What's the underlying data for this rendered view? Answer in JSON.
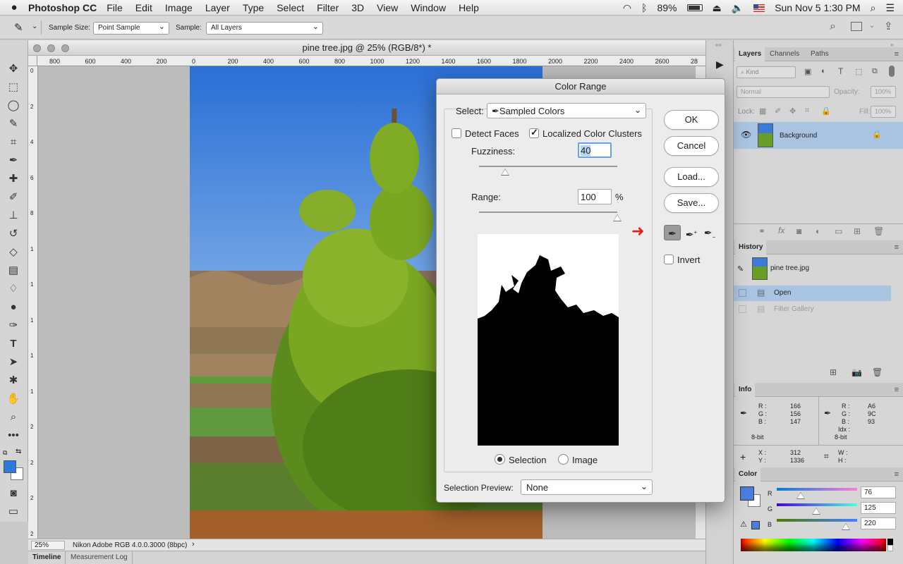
{
  "menubar": {
    "apple": "",
    "app_name": "Photoshop CC",
    "items": [
      "File",
      "Edit",
      "Image",
      "Layer",
      "Type",
      "Select",
      "Filter",
      "3D",
      "View",
      "Window",
      "Help"
    ],
    "battery": "89%",
    "datetime": "Sun Nov 5  1:30 PM"
  },
  "options": {
    "sample_size_label": "Sample Size:",
    "sample_size_value": "Point Sample",
    "sample_label": "Sample:",
    "sample_value": "All Layers"
  },
  "document": {
    "title": "pine tree.jpg @ 25% (RGB/8*) *",
    "zoom": "25%",
    "profile": "Nikon Adobe RGB 4.0.0.3000 (8bpc)",
    "ruler_h": [
      "800",
      "600",
      "400",
      "200",
      "0",
      "200",
      "400",
      "600",
      "800",
      "1000",
      "1200",
      "1400",
      "1600",
      "1800",
      "2000",
      "2200",
      "2400",
      "2600",
      "28"
    ],
    "ruler_v": [
      "0",
      "2",
      "4",
      "6",
      "8",
      "1",
      "1",
      "1",
      "1",
      "1",
      "2",
      "2",
      "2",
      "2"
    ]
  },
  "bottom_tabs": [
    "Timeline",
    "Measurement Log"
  ],
  "dialog": {
    "title": "Color Range",
    "select_label": "Select:",
    "select_value": "Sampled Colors",
    "detect_faces": "Detect Faces",
    "localized": "Localized Color Clusters",
    "fuzziness_label": "Fuzziness:",
    "fuzziness_value": "40",
    "fuzziness_level": 0.19,
    "range_label": "Range:",
    "range_value": "100",
    "range_unit": "%",
    "range_level": 1.0,
    "ok": "OK",
    "cancel": "Cancel",
    "load": "Load...",
    "save": "Save...",
    "invert": "Invert",
    "selection_radio": "Selection",
    "image_radio": "Image",
    "preview_label": "Selection Preview:",
    "preview_value": "None"
  },
  "layers": {
    "tabs": [
      "Layers",
      "Channels",
      "Paths"
    ],
    "kind": "Kind",
    "blend": "Normal",
    "opacity_label": "Opacity:",
    "opacity": "100%",
    "lock_label": "Lock:",
    "fill_label": "Fill:",
    "fill": "100%",
    "layer_name": "Background"
  },
  "history": {
    "title": "History",
    "snapshot": "pine tree.jpg",
    "items": [
      "Open",
      "Filter Gallery"
    ]
  },
  "info": {
    "title": "Info",
    "r_label": "R :",
    "g_label": "G :",
    "b_label": "B :",
    "r1": "166",
    "g1": "156",
    "b1": "147",
    "r2": "A6",
    "g2": "9C",
    "b2": "93",
    "idx_label": "Idx :",
    "bit1": "8-bit",
    "bit2": "8-bit",
    "x_label": "X :",
    "y_label": "Y :",
    "x": "312",
    "y": "1336",
    "w_label": "W :",
    "h_label": "H :"
  },
  "color": {
    "title": "Color",
    "r_label": "R",
    "g_label": "G",
    "b_label": "B",
    "r": "76",
    "g": "125",
    "b": "220",
    "fg": "#4c7ddc"
  }
}
